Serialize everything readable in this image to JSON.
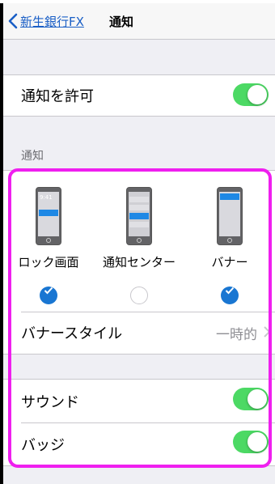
{
  "navbar": {
    "back_label": "新生銀行FX",
    "title": "通知"
  },
  "allow": {
    "label": "通知を許可",
    "enabled": true
  },
  "section_header": "通知",
  "alert_styles": [
    {
      "label": "ロック画面",
      "checked": true,
      "icon": "lock-screen-phone-icon",
      "time": "9:41"
    },
    {
      "label": "通知センター",
      "checked": false,
      "icon": "notification-center-phone-icon"
    },
    {
      "label": "バナー",
      "checked": true,
      "icon": "banner-phone-icon"
    }
  ],
  "banner_style": {
    "label": "バナースタイル",
    "value": "一時的"
  },
  "sound": {
    "label": "サウンド",
    "enabled": true
  },
  "badge": {
    "label": "バッジ",
    "enabled": true
  },
  "colors": {
    "toggle_on": "#4cd964",
    "check_on": "#1976d2",
    "highlight": "#ef1fef",
    "link": "#1a5fc6"
  }
}
